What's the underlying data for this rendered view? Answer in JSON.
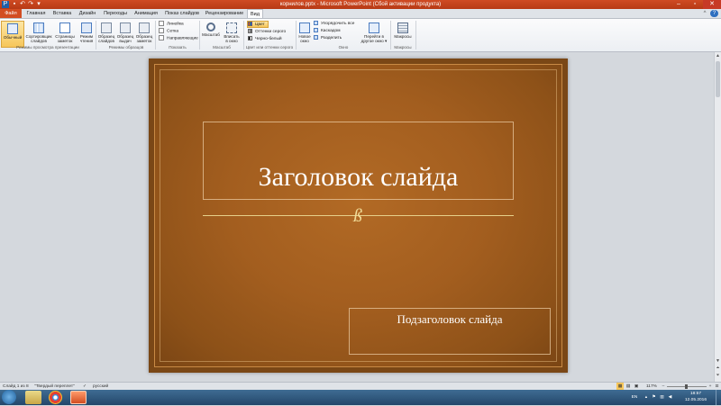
{
  "window": {
    "title": "корнилов.pptx - Microsoft PowerPoint (Сбой активации продукта)"
  },
  "tabs": [
    {
      "label": "Файл"
    },
    {
      "label": "Главная"
    },
    {
      "label": "Вставка"
    },
    {
      "label": "Дизайн"
    },
    {
      "label": "Переходы"
    },
    {
      "label": "Анимация"
    },
    {
      "label": "Показ слайдов"
    },
    {
      "label": "Рецензирование"
    },
    {
      "label": "Вид"
    }
  ],
  "ribbon": {
    "groups": {
      "views": "Режимы просмотра презентации",
      "masters": "Режимы образцов",
      "show": "Показать",
      "zoom": "Масштаб",
      "color": "Цвет или оттенки серого",
      "window": "Окно",
      "macros": "Макросы"
    },
    "views": [
      {
        "l1": "Обычный",
        "l2": ""
      },
      {
        "l1": "Сортировщик",
        "l2": "слайдов"
      },
      {
        "l1": "Страницы",
        "l2": "заметок"
      },
      {
        "l1": "Режим",
        "l2": "чтения"
      }
    ],
    "masters": [
      {
        "l1": "Образец",
        "l2": "слайдов"
      },
      {
        "l1": "Образец",
        "l2": "выдач"
      },
      {
        "l1": "Образец",
        "l2": "заметок"
      }
    ],
    "show": {
      "ruler": "Линейка",
      "grid": "Сетка",
      "guides": "Направляющие"
    },
    "zoom": [
      {
        "l1": "Масштаб",
        "l2": ""
      },
      {
        "l1": "Вписать",
        "l2": "в окно"
      }
    ],
    "color": {
      "color": "Цвет",
      "gray": "Оттенки серого",
      "bw": "Черно-белый"
    },
    "window": {
      "new": {
        "l1": "Новое",
        "l2": "окно"
      },
      "arrange": "Упорядочить все",
      "cascade": "Каскадом",
      "split": "Разделить",
      "switch": {
        "l1": "Перейти в",
        "l2": "другое окно"
      }
    },
    "macros": {
      "l1": "Макросы"
    }
  },
  "slide": {
    "title": "Заголовок слайда",
    "ornament": "ß",
    "subtitle": "Подзаголовок  слайда"
  },
  "status": {
    "slide_info": "Слайд 1 из 8",
    "theme": "\"Твердый переплет\"",
    "language": "русский",
    "zoom": "117%"
  },
  "taskbar": {
    "lang": "EN",
    "time": "18:57",
    "date": "12.05.2016"
  },
  "colors": {
    "accent": "#d24d22",
    "slide_bg": "#a35e1f",
    "ornament": "#f1dd9a"
  }
}
